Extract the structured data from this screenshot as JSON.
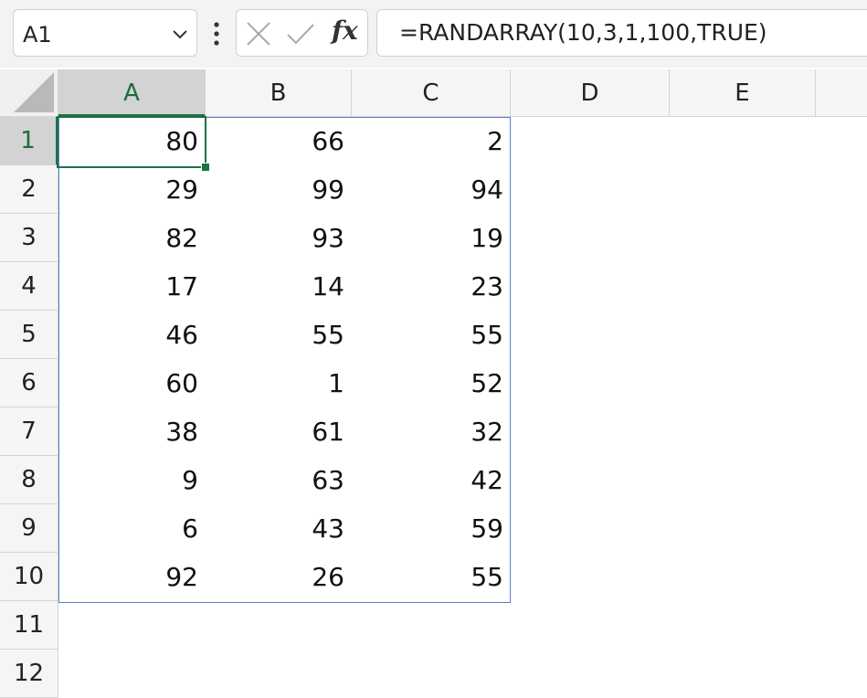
{
  "name_box": {
    "value": "A1"
  },
  "formula_bar": {
    "formula": "=RANDARRAY(10,3,1,100,TRUE)",
    "fx_label": "fx"
  },
  "columns": [
    "A",
    "B",
    "C",
    "D",
    "E"
  ],
  "rows": [
    "1",
    "2",
    "3",
    "4",
    "5",
    "6",
    "7",
    "8",
    "9",
    "10",
    "11",
    "12"
  ],
  "cells": [
    [
      "80",
      "66",
      "2"
    ],
    [
      "29",
      "99",
      "94"
    ],
    [
      "82",
      "93",
      "19"
    ],
    [
      "17",
      "14",
      "23"
    ],
    [
      "46",
      "55",
      "55"
    ],
    [
      "60",
      "1",
      "52"
    ],
    [
      "38",
      "61",
      "32"
    ],
    [
      "9",
      "63",
      "42"
    ],
    [
      "6",
      "43",
      "59"
    ],
    [
      "92",
      "26",
      "55"
    ]
  ],
  "selection": {
    "active_cell": "A1"
  },
  "colors": {
    "accent": "#1e7145",
    "spill_border": "#5b7fc4"
  }
}
